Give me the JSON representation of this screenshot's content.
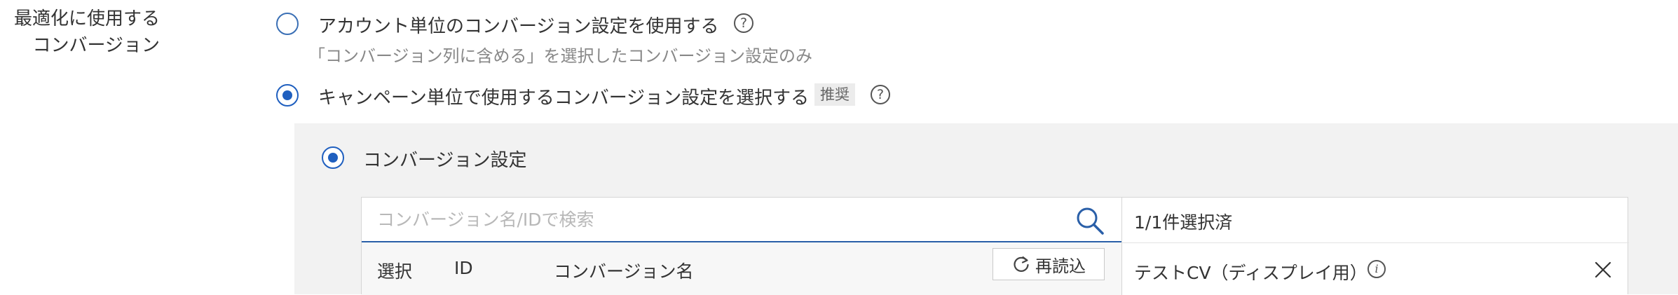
{
  "section_label": {
    "line1": "最適化に使用する",
    "line2": "コンバージョン"
  },
  "options": [
    {
      "label": "アカウント単位のコンバージョン設定を使用する",
      "description": "「コンバージョン列に含める」を選択したコンバージョン設定のみ",
      "selected": false,
      "help_icon": "question-circle-icon"
    },
    {
      "label": "キャンペーン単位で使用するコンバージョン設定を選択する",
      "badge": "推奨",
      "selected": true,
      "help_icon": "question-circle-icon"
    }
  ],
  "conversion_setting": {
    "label": "コンバージョン設定",
    "selected": true
  },
  "search": {
    "placeholder": "コンバージョン名/IDで検索",
    "icon": "search-icon"
  },
  "table": {
    "columns": [
      "選択",
      "ID",
      "コンバージョン名"
    ],
    "reload_label": "再読込",
    "reload_icon": "refresh-icon"
  },
  "selected_panel": {
    "count_text": "1/1件選択済",
    "items": [
      {
        "name": "テストCV（ディスプレイ用）",
        "info_icon": "info-icon",
        "remove_icon": "close-icon"
      }
    ]
  },
  "colors": {
    "accent": "#1f5fbf",
    "panel_bg": "#f2f2f2",
    "muted_text": "#888888"
  }
}
